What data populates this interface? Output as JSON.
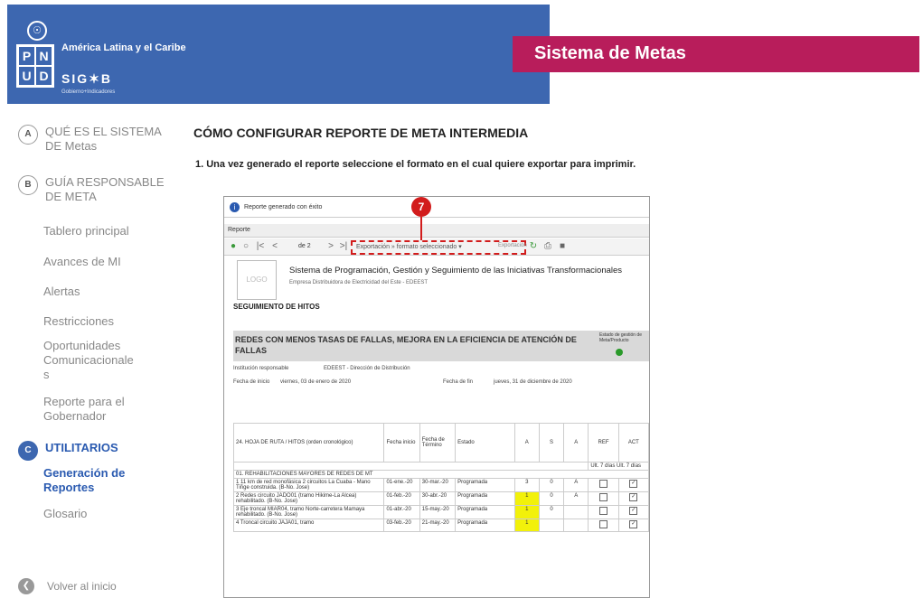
{
  "header": {
    "un_emblem_icon": "un-emblem",
    "pnud_letters": [
      "P",
      "N",
      "U",
      "D"
    ],
    "region": "América Latina y el Caribe",
    "sigob": "SIG✶B",
    "sigob_sub": "Gobierno+Indicadores",
    "system_title": "Sistema de Metas"
  },
  "sidebar": {
    "sections": [
      {
        "letter": "A",
        "label": "QUÉ ES EL SISTEMA DE Metas"
      },
      {
        "letter": "B",
        "label": "GUÍA RESPONSABLE DE META"
      },
      {
        "letter": "C",
        "label": "UTILITARIOS"
      }
    ],
    "items_b": [
      "Tablero principal",
      "Avances de MI",
      "Alertas",
      "Restricciones",
      "Oportunidades Comunicacionale s",
      "Reporte para el Gobernador"
    ],
    "items_c": [
      "Generación de Reportes",
      "Glosario"
    ],
    "back": "Volver al inicio"
  },
  "main": {
    "title": "CÓMO CONFIGURAR REPORTE DE META INTERMEDIA",
    "step": "1.  Una vez generado el reporte seleccione el formato en el cual quiere exportar para imprimir."
  },
  "shot": {
    "info": "Reporte generado con éxito",
    "tab": "Reporte",
    "page_of": "de 2",
    "export_select": "Exportación » formato seleccionado ▾",
    "export_link": "Exportación",
    "badge": "7",
    "logo": "LOGO",
    "report_title": "Sistema de Programación, Gestión y Seguimiento de las Iniciativas Transformacionales",
    "report_sub": "Empresa Distribuidora de Electricidad del Este - EDEEST",
    "seguimiento": "SEGUIMIENTO DE HITOS",
    "meta_title": "REDES CON MENOS TASAS DE FALLAS, MEJORA EN LA EFICIENCIA DE ATENCIÓN DE FALLAS",
    "estado_label": "Estado de gestión de Meta/Producto",
    "inst_label": "Institución responsable",
    "inst_value": "EDEEST - Dirección de Distribución",
    "fecha_inicio_label": "Fecha de inicio",
    "fecha_inicio_value": "viernes, 03 de enero de 2020",
    "fecha_fin_label": "Fecha de fin",
    "fecha_fin_value": "jueves, 31 de diciembre de 2020",
    "table": {
      "headers": [
        "24. HOJA DE RUTA / HITOS (orden cronológico)",
        "Fecha inicio",
        "Fecha de Término",
        "Estado",
        "A",
        "S",
        "A",
        "REF",
        "ACT"
      ],
      "ult": "Ult. 7 días   Ult. 7 días",
      "group": "01. REHABILITACIONES MAYORES DE REDES DE MT",
      "rows": [
        {
          "n": "1",
          "desc": "11 km de red monofásica 2 circuitos La Cuaba - Mano Tiñge construida. (B-No. Jose)",
          "ini": "01-ene.-20",
          "fin": "30-mar.-20",
          "estado": "Programada",
          "a": "3",
          "s": "0",
          "a2": "A",
          "yellow": false
        },
        {
          "n": "2",
          "desc": "Redes circuito JADO01 (tramo Hikime-La Alcea) rehabilitado. (B-No. Jose)",
          "ini": "01-feb.-20",
          "fin": "30-abr.-20",
          "estado": "Programada",
          "a": "1",
          "s": "0",
          "a2": "A",
          "yellow": true
        },
        {
          "n": "3",
          "desc": "Eje troncal MIAR04, tramo Norte-carretera Mamaya rehabilitado. (B-No. Jose)",
          "ini": "01-abr.-20",
          "fin": "15-may.-20",
          "estado": "Programada",
          "a": "1",
          "s": "0",
          "a2": "",
          "yellow": true
        },
        {
          "n": "4",
          "desc": "Troncal circuito JAJA01, tramo",
          "ini": "03-feb.-20",
          "fin": "21-may.-20",
          "estado": "Programada",
          "a": "1",
          "s": "",
          "a2": "",
          "yellow": true
        }
      ]
    }
  }
}
